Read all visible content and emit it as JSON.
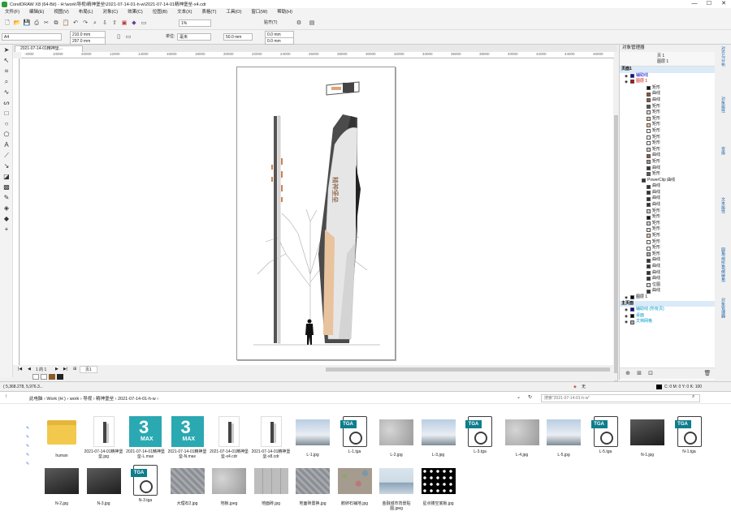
{
  "window": {
    "title": "CorelDRAW X8 (64-Bit) - H:\\work\\导视\\精神堡垒\\2021-07-14-01-h-w\\2021-07-14-01精神堡垒-x4.cdr"
  },
  "menu": [
    "文件(F)",
    "编辑(E)",
    "视图(V)",
    "布局(L)",
    "对象(C)",
    "效果(C)",
    "位图(B)",
    "文本(X)",
    "表格(T)",
    "工具(O)",
    "窗口(W)",
    "帮助(H)"
  ],
  "toolbar": {
    "zoom": "1%",
    "snap": "贴齐(T)"
  },
  "propbar": {
    "page_size": "A4",
    "width": "210.0 mm",
    "height": "297.0 mm",
    "unit_label": "单位:",
    "unit": "毫米",
    "nudge": "50.0 mm",
    "dup_x": "0.0 mm",
    "dup_y": "0.0 mm"
  },
  "doc_tab": "2021-07-14-01精神堡...",
  "ruler_ticks": [
    "-2000",
    "10000",
    "20000",
    "12000",
    "14000",
    "16000",
    "18000",
    "20000",
    "22000",
    "24000",
    "26000",
    "28000",
    "30000",
    "32000",
    "34000",
    "36000",
    "38000",
    "40000",
    "42000",
    "44000",
    "46000"
  ],
  "pagebar": {
    "counter": "1 的 1",
    "page_tab": "页1"
  },
  "objmgr": {
    "title": "对象管理器",
    "page_label": "页 1",
    "layer_label": "图层 1",
    "items": [
      {
        "t": "页面1",
        "ind": 2,
        "c": "#000",
        "bold": true
      },
      {
        "t": "辅助线",
        "ind": 20,
        "c": "#0000cc",
        "sw": "#0000cc"
      },
      {
        "t": "图层 1",
        "ind": 20,
        "c": "#cc0000",
        "sw": "#cc0000"
      },
      {
        "t": "矩形",
        "ind": 40,
        "sw": "#111"
      },
      {
        "t": "曲线",
        "ind": 40,
        "sw": "#a0522d"
      },
      {
        "t": "曲线",
        "ind": 40,
        "sw": "#a0522d"
      },
      {
        "t": "矩形",
        "ind": 40,
        "sw": "#555"
      },
      {
        "t": "矩形",
        "ind": 40,
        "sw": "#ddd"
      },
      {
        "t": "矩形",
        "ind": 40,
        "sw": "#e8c39e"
      },
      {
        "t": "矩形",
        "ind": 40,
        "sw": "#e8c39e"
      },
      {
        "t": "矩形",
        "ind": 40,
        "sw": "#fff"
      },
      {
        "t": "矩形",
        "ind": 40,
        "sw": "#fff"
      },
      {
        "t": "矩形",
        "ind": 40,
        "sw": "#fff"
      },
      {
        "t": "矩形",
        "ind": 40,
        "sw": "#ccc"
      },
      {
        "t": "曲线",
        "ind": 40,
        "sw": "#a0522d"
      },
      {
        "t": "矩形",
        "ind": 40,
        "sw": "#999"
      },
      {
        "t": "曲线",
        "ind": 40,
        "sw": "#333"
      },
      {
        "t": "矩形",
        "ind": 40,
        "sw": "#555"
      },
      {
        "t": "PowerClip 曲线",
        "ind": 34,
        "sw": "#333"
      },
      {
        "t": "曲线",
        "ind": 40,
        "sw": "#333"
      },
      {
        "t": "曲线",
        "ind": 40,
        "sw": "#333"
      },
      {
        "t": "曲线",
        "ind": 40,
        "sw": "#333"
      },
      {
        "t": "曲线",
        "ind": 40,
        "sw": "#333"
      },
      {
        "t": "矩形",
        "ind": 40,
        "sw": "#ccc"
      },
      {
        "t": "矩形",
        "ind": 40,
        "sw": "#111"
      },
      {
        "t": "矩形",
        "ind": 40,
        "sw": "#ccc"
      },
      {
        "t": "矩形",
        "ind": 40,
        "sw": "#ddd"
      },
      {
        "t": "矩形",
        "ind": 40,
        "sw": "#e8c39e"
      },
      {
        "t": "矩形",
        "ind": 40,
        "sw": "#fff"
      },
      {
        "t": "矩形",
        "ind": 40,
        "sw": "#fff"
      },
      {
        "t": "矩形",
        "ind": 40,
        "sw": "#aaa"
      },
      {
        "t": "曲线",
        "ind": 40,
        "sw": "#333"
      },
      {
        "t": "曲线",
        "ind": 40,
        "sw": "#333"
      },
      {
        "t": "曲线",
        "ind": 40,
        "sw": "#333"
      },
      {
        "t": "曲线",
        "ind": 40,
        "sw": "#333"
      },
      {
        "t": "位图",
        "ind": 40,
        "sw": "#ddd"
      },
      {
        "t": "曲线",
        "ind": 40,
        "sw": "#333"
      },
      {
        "t": "图层 1",
        "ind": 20,
        "c": "#000",
        "sw": "#000"
      },
      {
        "t": "主页面",
        "ind": 2,
        "c": "#000",
        "bold": true
      },
      {
        "t": "辅助线 (所有页)",
        "ind": 20,
        "c": "#0099cc",
        "sw": "#0000cc"
      },
      {
        "t": "桌面",
        "ind": 20,
        "c": "#0099cc",
        "sw": "#000"
      },
      {
        "t": "文档网格",
        "ind": 20,
        "c": "#0099cc",
        "sw": "#aaa"
      }
    ]
  },
  "dock_tabs": [
    "对齐与分布",
    "对象属性",
    "变换",
    "文本属性",
    "圆角/扇形角/倒棱角",
    "对象管理器"
  ],
  "status": {
    "coords": "( 5,368.278, 5,976.3...",
    "fill": "无",
    "color": "C: 0 M: 0 Y: 0 K: 100"
  },
  "explorer": {
    "breadcrumb": "此电脑  ›  Work (H:)  ›  work  ›  导视  ›  精神堡垒  ›  2021-07-14-01-h-w  ›",
    "search": "搜索\"2021-07-14-01-h-w\"",
    "files": [
      {
        "name": "human",
        "kind": "folder"
      },
      {
        "name": "2021-07-14-01精神堡垒.jpg",
        "kind": "doc"
      },
      {
        "name": "2021-07-14-01精神堡垒-L.max",
        "kind": "max"
      },
      {
        "name": "2021-07-14-01精神堡垒-N.max",
        "kind": "max"
      },
      {
        "name": "2021-07-14-01精神堡垒-x4.cdr",
        "kind": "doc"
      },
      {
        "name": "2021-07-14-01精神堡垒-x8.cdr",
        "kind": "doc"
      },
      {
        "name": "L-1.jpg",
        "kind": "sky"
      },
      {
        "name": "L-1.tga",
        "kind": "tga"
      },
      {
        "name": "L-2.jpg",
        "kind": "gray"
      },
      {
        "name": "L-3.jpg",
        "kind": "sky"
      },
      {
        "name": "L-3.tga",
        "kind": "tga"
      },
      {
        "name": "L-4.jpg",
        "kind": "gray"
      },
      {
        "name": "L-5.jpg",
        "kind": "sky"
      },
      {
        "name": "L-5.tga",
        "kind": "tga"
      },
      {
        "name": "N-1.jpg",
        "kind": "dark"
      },
      {
        "name": "N-1.tga",
        "kind": "tga"
      },
      {
        "name": "N-2.jpg",
        "kind": "dark"
      },
      {
        "name": "N-3.jpg",
        "kind": "dark"
      },
      {
        "name": "N-3.tga",
        "kind": "tga"
      },
      {
        "name": "大理石2.jpg",
        "kind": "stone"
      },
      {
        "name": "地板.jpeg",
        "kind": "gray"
      },
      {
        "name": "地面砖.jpg",
        "kind": "stone2"
      },
      {
        "name": "地面砖置换.jpg",
        "kind": "stone"
      },
      {
        "name": "鹅卵石铺地.jpg",
        "kind": "peb"
      },
      {
        "name": "金融城市背景贴图.jpeg",
        "kind": "city"
      },
      {
        "name": "星点镂空底板.jpg",
        "kind": "star"
      }
    ]
  },
  "colors": {
    "accent": "#0078d7",
    "brand_3dsmax": "#2aa9b2",
    "tga_badge": "#0e7d8c"
  }
}
